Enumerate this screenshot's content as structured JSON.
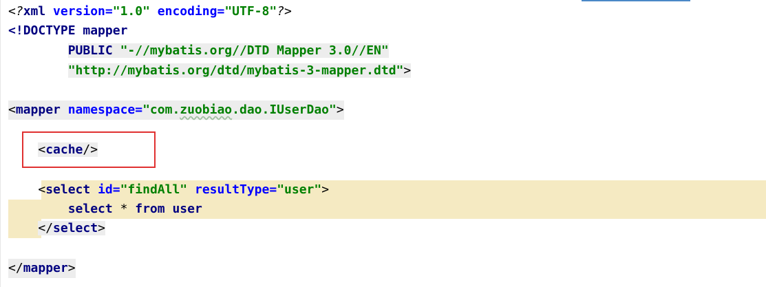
{
  "editor": {
    "language": "xml",
    "lines": {
      "l1": {
        "pi_open": "<?",
        "pi_name": "xml",
        "attr1_name": " version",
        "eq1": "=",
        "attr1_value": "\"1.0\"",
        "attr2_name": " encoding",
        "eq2": "=",
        "attr2_value": "\"UTF-8\"",
        "pi_close": "?>"
      },
      "l2": {
        "open": "<!",
        "name": "DOCTYPE",
        "rest": " mapper"
      },
      "l3": {
        "indent": "        ",
        "kw": "PUBLIC",
        "space": " ",
        "value": "\"-//mybatis.org//DTD Mapper 3.0//EN\""
      },
      "l4": {
        "indent": "        ",
        "value": "\"http://mybatis.org/dtd/mybatis-3-mapper.dtd\"",
        "close": ">"
      },
      "l6": {
        "open": "<",
        "tag": "mapper",
        "attr": " namespace",
        "eq": "=",
        "value_pre": "\"com.",
        "value_squiggle": "zuobiao",
        "value_post": ".dao.IUserDao\"",
        "close": ">"
      },
      "l8": {
        "indent": "    ",
        "open": "<",
        "tag": "cache",
        "close": "/>"
      },
      "l10": {
        "indent": "    ",
        "open": "<",
        "tag": "select",
        "attr1": " id",
        "eq1": "=",
        "val1": "\"findAll\"",
        "attr2": " resultType",
        "eq2": "=",
        "val2": "\"user\"",
        "close": ">"
      },
      "l11": {
        "indent": "        ",
        "kw1": "select",
        "mid": " * ",
        "kw2": "from",
        "sp": " ",
        "word": "user"
      },
      "l12": {
        "indent": "    ",
        "open": "</",
        "tag": "select",
        "close": ">"
      },
      "l14": {
        "open": "</",
        "tag": "mapper",
        "close": ">"
      }
    }
  },
  "colors": {
    "tag": "#000080",
    "attribute": "#0000ff",
    "string": "#008000",
    "highlight_band": "#f5eac2",
    "annotation_box": "#e03030"
  }
}
